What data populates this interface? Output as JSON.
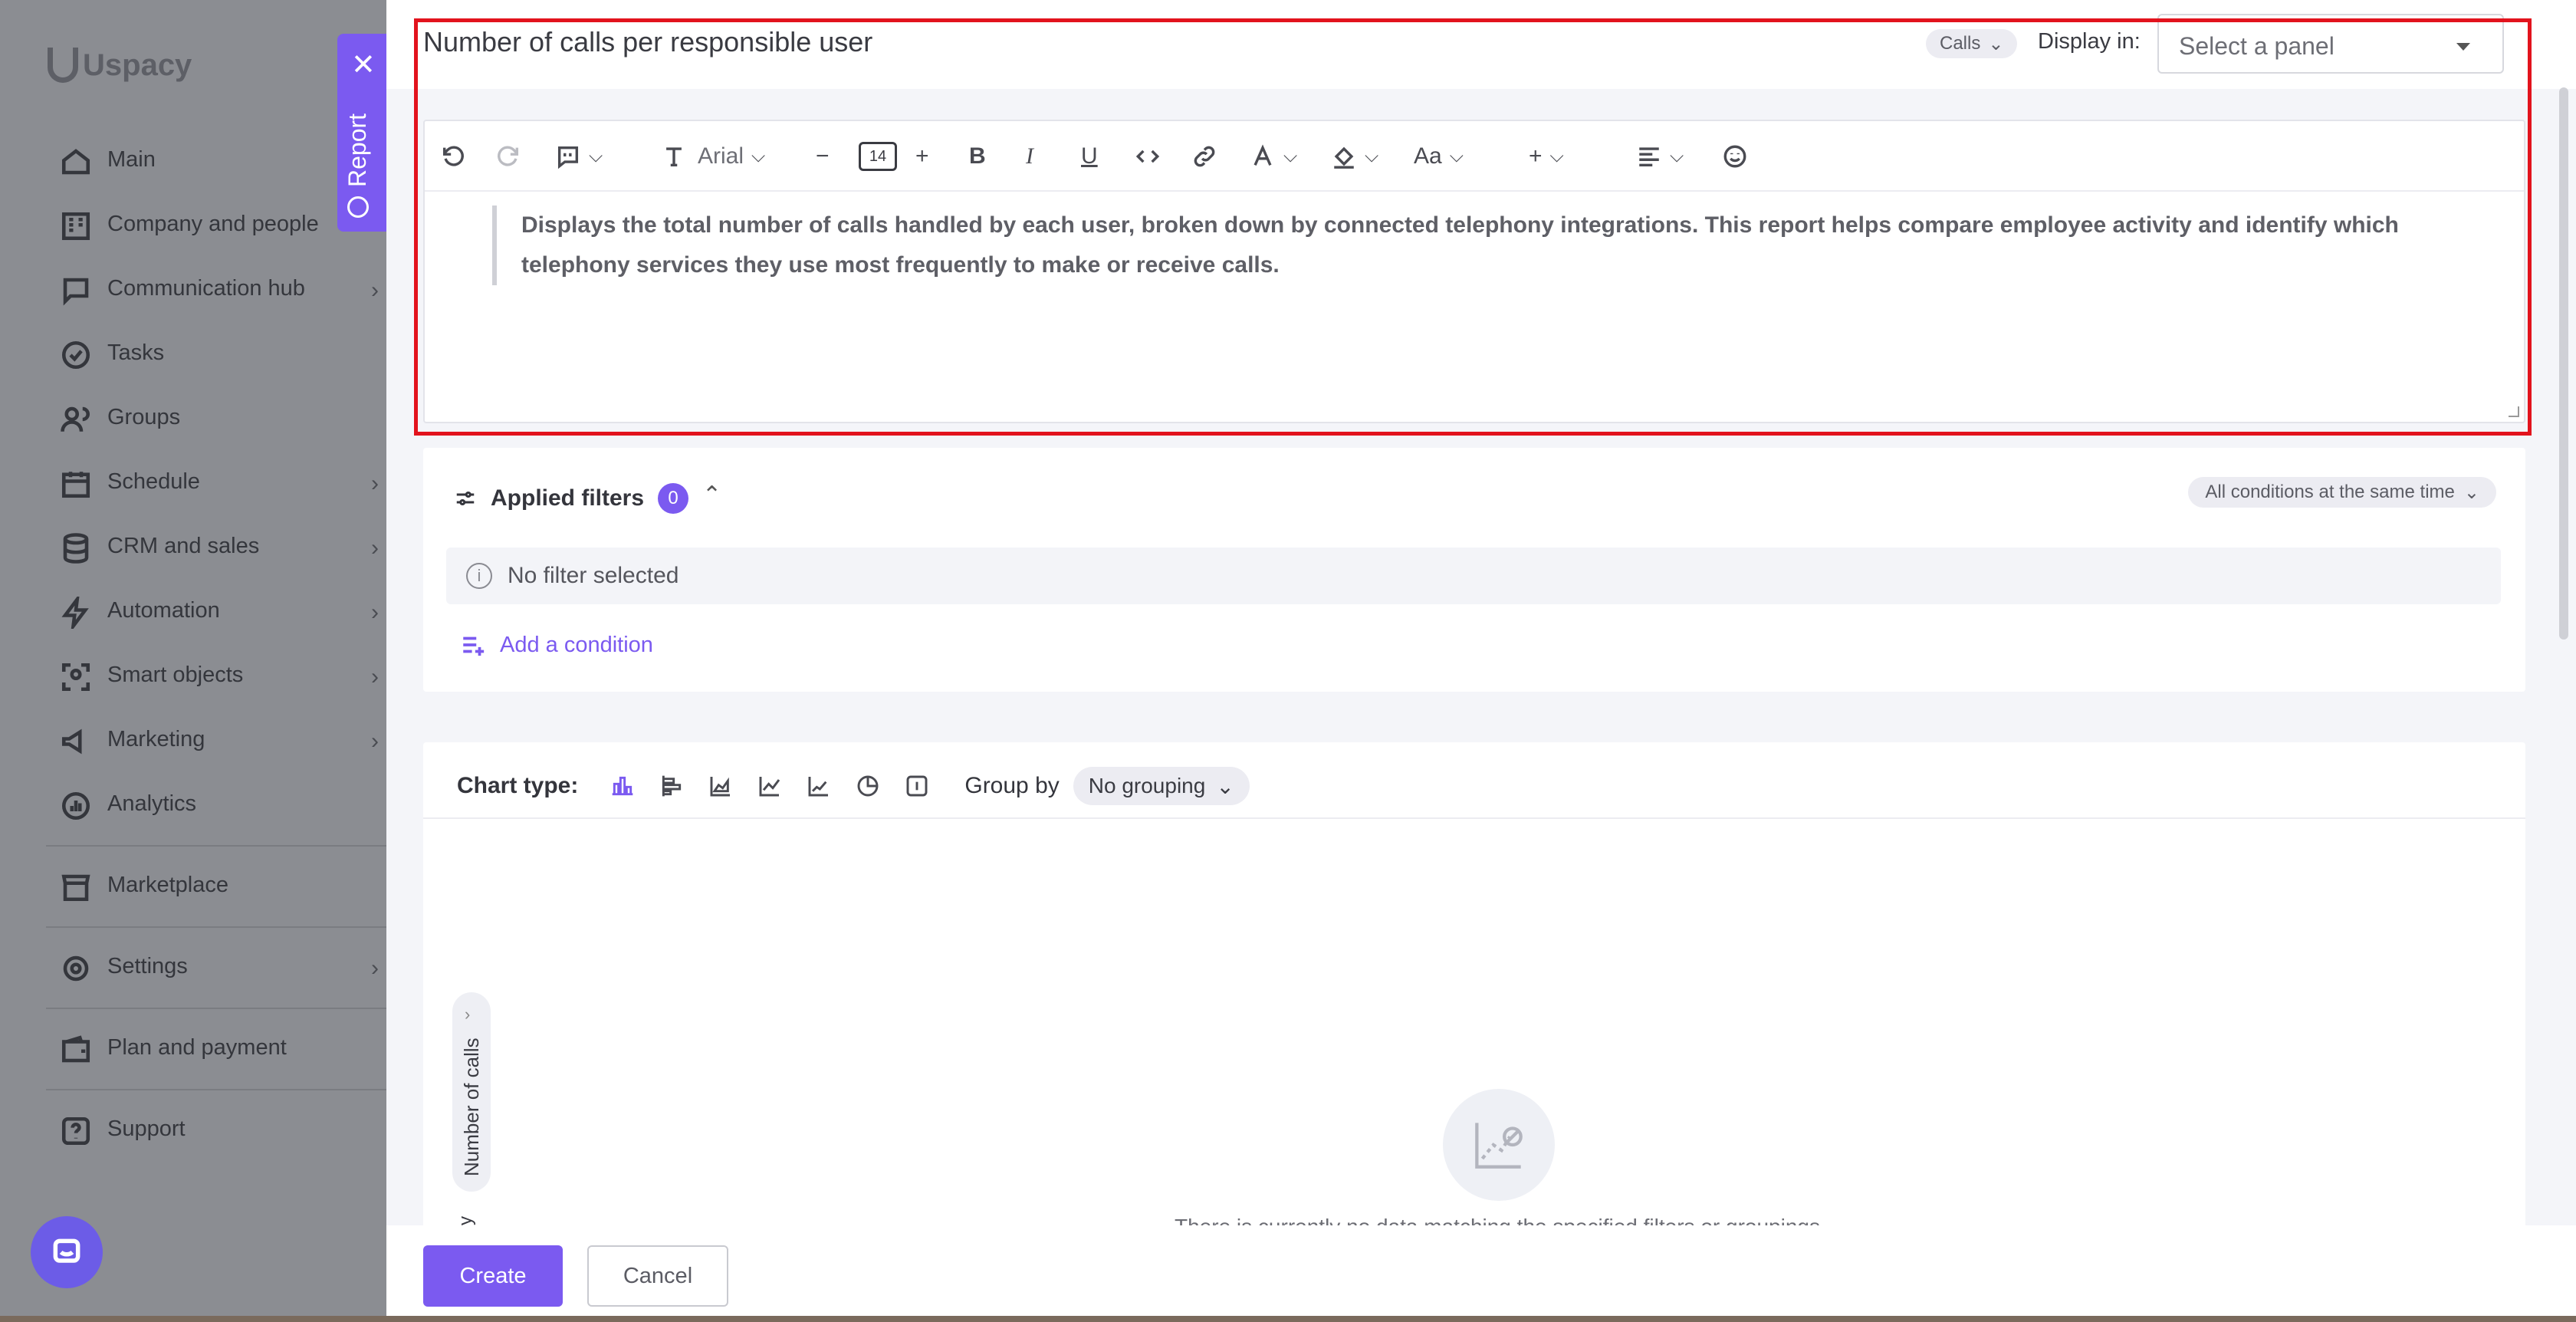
{
  "sidebar": {
    "logo": "Uspacy",
    "items": [
      {
        "label": "Main",
        "icon": "home-icon",
        "has_submenu": false
      },
      {
        "label": "Company and people",
        "icon": "company-icon",
        "has_submenu": false
      },
      {
        "label": "Communication hub",
        "icon": "chat-icon",
        "has_submenu": true
      },
      {
        "label": "Tasks",
        "icon": "check-circle-icon",
        "has_submenu": false
      },
      {
        "label": "Groups",
        "icon": "users-icon",
        "has_submenu": false
      },
      {
        "label": "Schedule",
        "icon": "calendar-icon",
        "has_submenu": true
      },
      {
        "label": "CRM and sales",
        "icon": "database-icon",
        "has_submenu": true
      },
      {
        "label": "Automation",
        "icon": "lightning-icon",
        "has_submenu": true
      },
      {
        "label": "Smart objects",
        "icon": "smart-objects-icon",
        "has_submenu": true
      },
      {
        "label": "Marketing",
        "icon": "megaphone-icon",
        "has_submenu": true
      },
      {
        "label": "Analytics",
        "icon": "analytics-icon",
        "has_submenu": false
      }
    ],
    "bottom_items": [
      {
        "label": "Marketplace",
        "icon": "store-icon",
        "has_submenu": false
      },
      {
        "label": "Settings",
        "icon": "gear-icon",
        "has_submenu": true
      },
      {
        "label": "Plan and payment",
        "icon": "wallet-icon",
        "has_submenu": false
      },
      {
        "label": "Support",
        "icon": "support-icon",
        "has_submenu": false
      }
    ]
  },
  "report_tab": {
    "label": "Report"
  },
  "header": {
    "title": "Number of calls per responsible user",
    "entity_pill": "Calls",
    "display_in_label": "Display in:",
    "panel_select_placeholder": "Select a panel"
  },
  "editor": {
    "font_name": "Arial",
    "font_size": "14",
    "case_label": "Aa",
    "body_text": "Displays the total number of calls handled by each user, broken down by connected telephony integrations. This report helps compare employee activity and identify which telephony services they use most frequently to make or receive calls."
  },
  "filters": {
    "title": "Applied filters",
    "count": "0",
    "mode": "All conditions at the same time",
    "empty_text": "No filter selected",
    "add_condition": "Add a condition"
  },
  "chart": {
    "type_label": "Chart type:",
    "types": [
      "column",
      "bar",
      "area",
      "line",
      "line-alt",
      "pie",
      "number"
    ],
    "active_type": "column",
    "group_by_label": "Group by",
    "group_by_value": "No grouping",
    "y_axis_label": "Number of calls",
    "x_axis_label": "y",
    "empty_text": "There is currently no data matching the specified filters or groupings"
  },
  "footer": {
    "create_label": "Create",
    "cancel_label": "Cancel"
  },
  "colors": {
    "accent": "#7b5af0",
    "highlight": "#e2131d",
    "overlay": "#7d7f84"
  }
}
